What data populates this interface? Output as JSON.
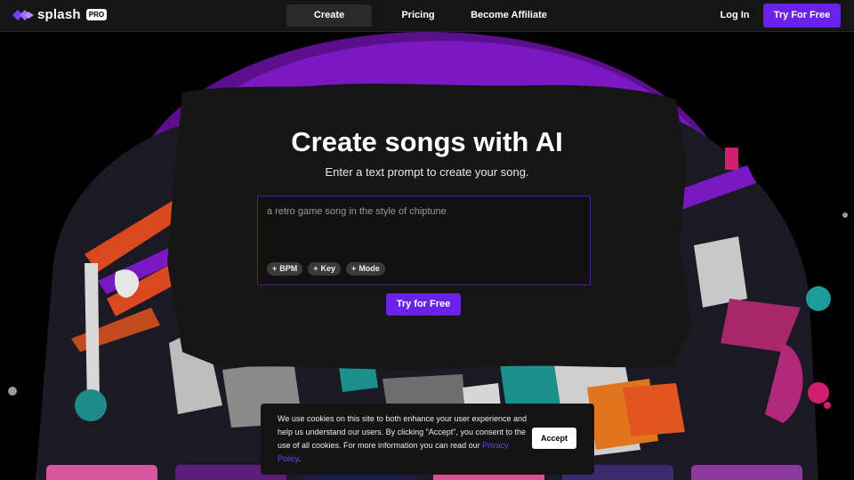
{
  "brand": {
    "name": "splash",
    "badge": "PRO",
    "accent": "#6b22e8"
  },
  "nav": {
    "links": [
      "Create",
      "Pricing",
      "Become Affiliate"
    ],
    "login": "Log In",
    "cta": "Try For Free"
  },
  "hero": {
    "title": "Create songs with AI",
    "subtitle": "Enter a text prompt to create your song.",
    "prompt_placeholder": "a retro game song in the style of chiptune",
    "chips": [
      "BPM",
      "Key",
      "Mode"
    ],
    "chip_icon": "+",
    "cta": "Try for Free"
  },
  "cookie": {
    "text": "We use cookies on this site to both enhance your user experience and help us understand our users. By clicking \"Accept\", you consent to the use of all cookies. For more information you can read our",
    "link": "Privacy Policy",
    "link_suffix": ".",
    "accept": "Accept"
  },
  "thumbnails": [
    {
      "name": "thumb-1",
      "color": "#d8569e"
    },
    {
      "name": "thumb-2",
      "color": "#5a1e7a"
    },
    {
      "name": "thumb-3",
      "color": "#1d1d4a"
    },
    {
      "name": "thumb-4",
      "color": "#e04e92"
    },
    {
      "name": "thumb-5",
      "color": "#3b2a6e"
    },
    {
      "name": "thumb-6",
      "color": "#8a3a9a"
    }
  ]
}
